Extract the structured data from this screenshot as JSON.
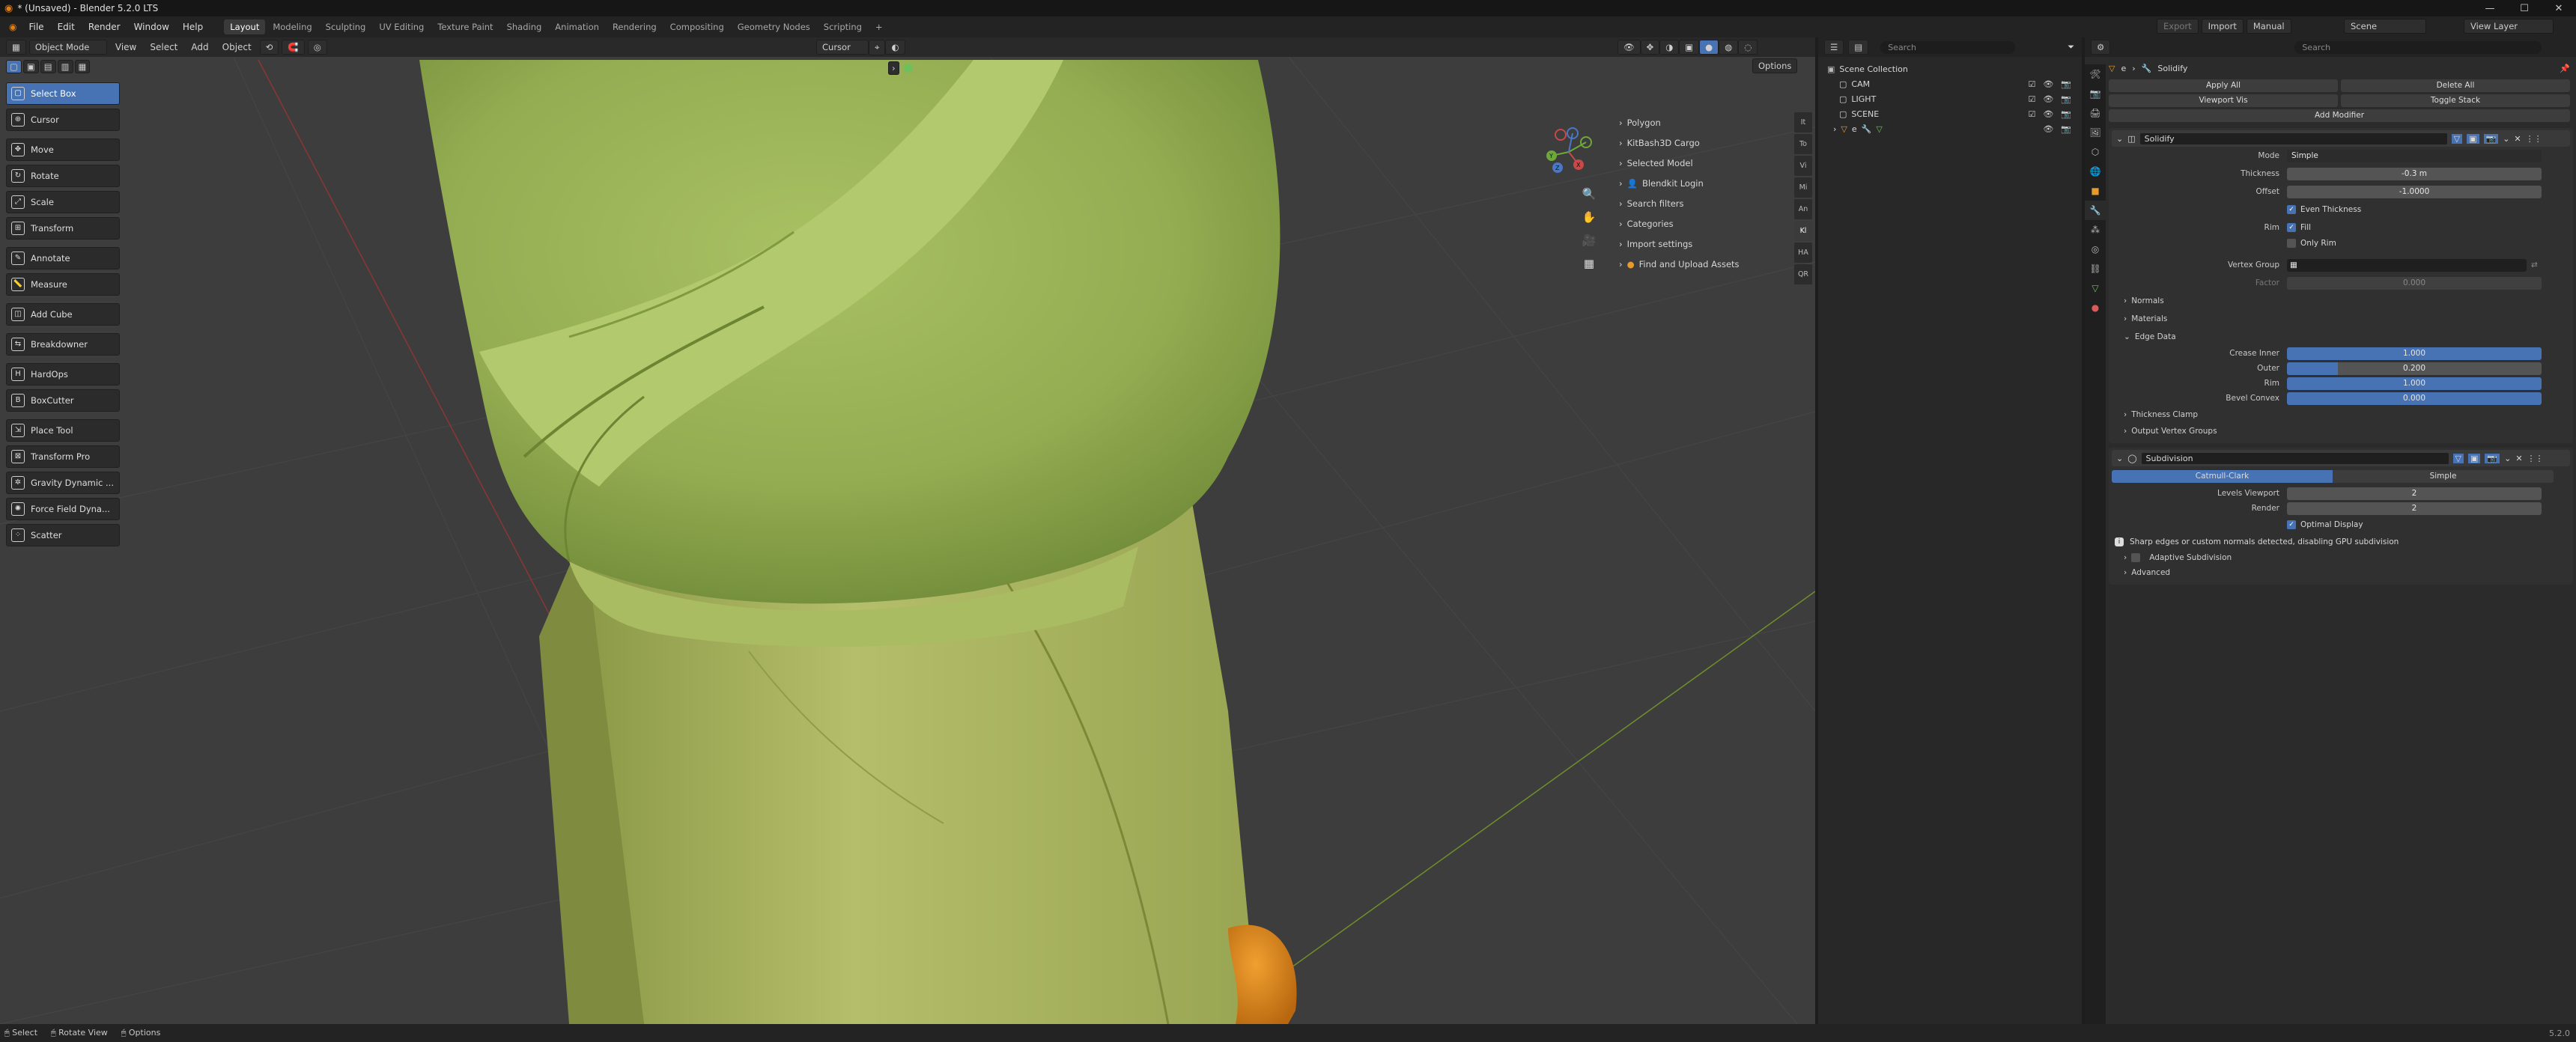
{
  "app": {
    "window_title": "* (Unsaved) - Blender 5.2.0 LTS",
    "menus": [
      "File",
      "Edit",
      "Render",
      "Window",
      "Help"
    ],
    "workspaces": [
      "Layout",
      "Modeling",
      "Sculpting",
      "UV Editing",
      "Texture Paint",
      "Shading",
      "Animation",
      "Rendering",
      "Compositing",
      "Geometry Nodes",
      "Scripting",
      "+"
    ],
    "active_workspace": "Layout",
    "export_label": "Export",
    "import_label": "Import",
    "manual_label": "Manual",
    "scene_label": "Scene",
    "viewlayer_label": "View Layer"
  },
  "viewport": {
    "mode": "Object Mode",
    "menus": [
      "View",
      "Select",
      "Add",
      "Object"
    ],
    "pivot_label": "Cursor",
    "options_label": "Options",
    "search_placeholder": "Search"
  },
  "tools": [
    {
      "label": "Select Box",
      "active": true,
      "icon": "select-box-icon"
    },
    {
      "label": "Cursor",
      "icon": "cursor-icon"
    },
    {
      "label": "Move",
      "icon": "move-icon"
    },
    {
      "label": "Rotate",
      "icon": "rotate-icon"
    },
    {
      "label": "Scale",
      "icon": "scale-icon"
    },
    {
      "label": "Transform",
      "icon": "transform-icon"
    },
    {
      "label": "Annotate",
      "icon": "annotate-icon"
    },
    {
      "label": "Measure",
      "icon": "measure-icon"
    },
    {
      "label": "Add Cube",
      "icon": "add-cube-icon"
    },
    {
      "label": "Breakdowner",
      "icon": "breakdowner-icon"
    },
    {
      "label": "HardOps",
      "icon": "hardops-icon"
    },
    {
      "label": "BoxCutter",
      "icon": "boxcutter-icon"
    },
    {
      "label": "Place Tool",
      "icon": "place-tool-icon"
    },
    {
      "label": "Transform Pro",
      "icon": "transform-pro-icon"
    },
    {
      "label": "Gravity Dynamic ...",
      "icon": "gravity-icon"
    },
    {
      "label": "Force Field Dyna...",
      "icon": "force-field-icon"
    },
    {
      "label": "Scatter",
      "icon": "scatter-icon"
    }
  ],
  "npanel": {
    "items": [
      "Polygon",
      "KitBash3D Cargo",
      "Selected Model",
      "Blendkit Login",
      "Search filters",
      "Categories",
      "Import settings",
      "Find and Upload Assets"
    ],
    "tabs": [
      "It",
      "To",
      "Vi",
      "Mi",
      "An",
      "Kl",
      "HA",
      "QR"
    ]
  },
  "outliner": {
    "search_placeholder": "Search",
    "root": "Scene Collection",
    "items": [
      {
        "label": "CAM"
      },
      {
        "label": "LIGHT"
      },
      {
        "label": "SCENE"
      },
      {
        "label": "e"
      }
    ]
  },
  "properties": {
    "search_placeholder": "Search",
    "breadcrumb_object": "e",
    "breadcrumb_modifier": "Solidify",
    "apply_all": "Apply All",
    "delete_all": "Delete All",
    "viewport_vis": "Viewport Vis",
    "toggle_stack": "Toggle Stack",
    "add_modifier": "Add Modifier",
    "solidify": {
      "name": "Solidify",
      "mode_label": "Mode",
      "mode_value": "Simple",
      "thickness_label": "Thickness",
      "thickness_value": "-0.3 m",
      "offset_label": "Offset",
      "offset_value": "-1.0000",
      "even_thickness": "Even Thickness",
      "rim_label": "Rim",
      "fill": "Fill",
      "only_rim": "Only Rim",
      "vertex_group_label": "Vertex Group",
      "factor_label": "Factor",
      "factor_value": "0.000",
      "normals": "Normals",
      "materials": "Materials",
      "edge_data": "Edge Data",
      "crease_inner_label": "Crease Inner",
      "crease_inner_value": "1.000",
      "outer_label": "Outer",
      "outer_value": "0.200",
      "outer_fraction": 0.2,
      "rim_crease_label": "Rim",
      "rim_crease_value": "1.000",
      "bevel_convex_label": "Bevel Convex",
      "bevel_convex_value": "0.000",
      "thickness_clamp": "Thickness Clamp",
      "output_vertex_groups": "Output Vertex Groups"
    },
    "subdivision": {
      "name": "Subdivision",
      "catmull": "Catmull-Clark",
      "simple": "Simple",
      "levels_viewport_label": "Levels Viewport",
      "levels_viewport_value": "2",
      "render_label": "Render",
      "render_value": "2",
      "optimal_display": "Optimal Display",
      "warning": "Sharp edges or custom normals detected, disabling GPU subdivision",
      "adaptive": "Adaptive Subdivision",
      "advanced": "Advanced"
    }
  },
  "status": {
    "select": "Select",
    "rotate_view": "Rotate View",
    "options": "Options",
    "version": "5.2.0"
  }
}
